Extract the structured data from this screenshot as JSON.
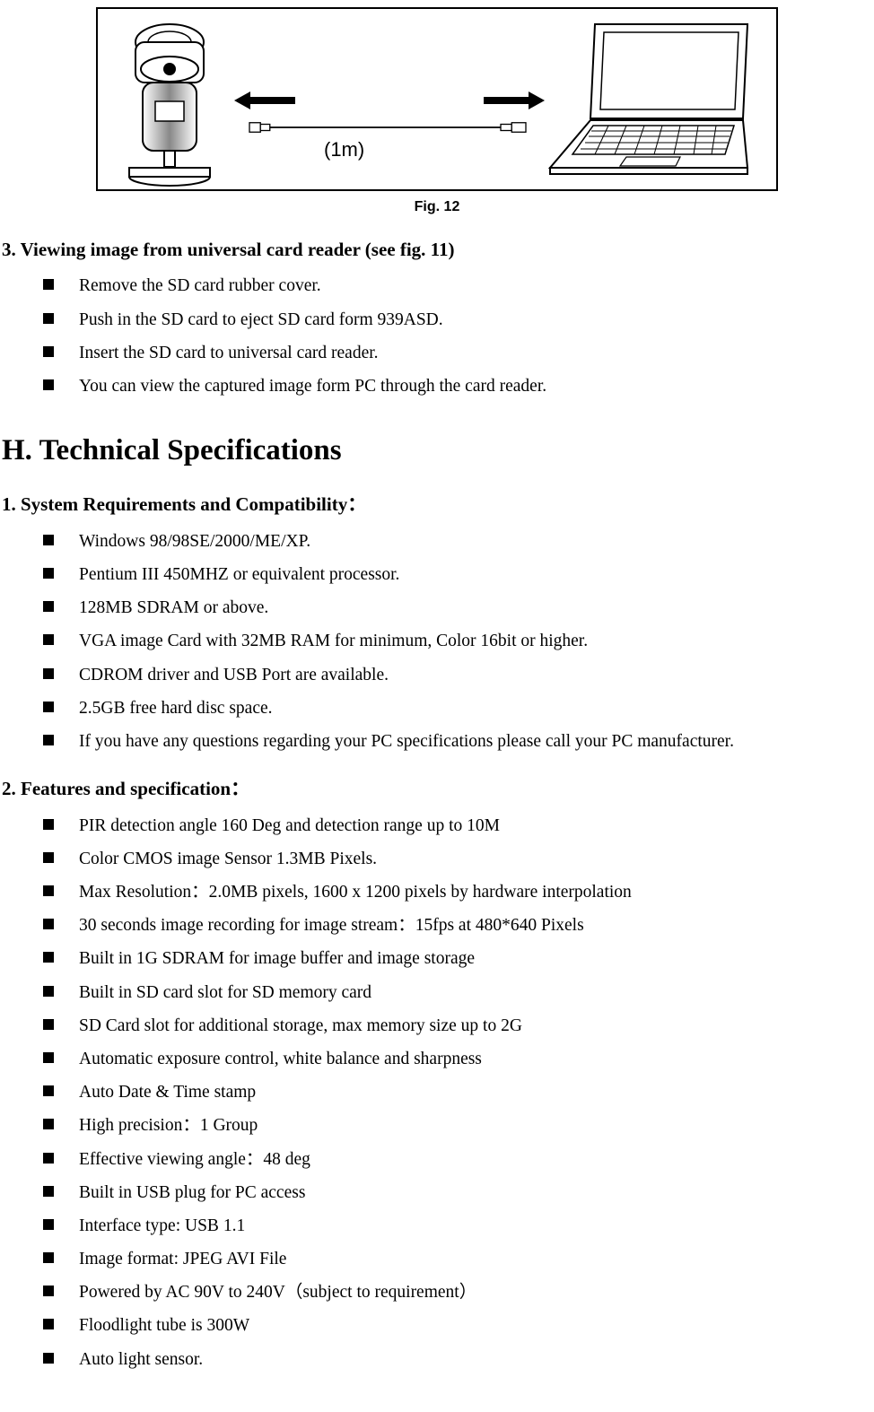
{
  "figure": {
    "cable_label": "(1m)",
    "caption": "Fig. 12"
  },
  "section3": {
    "heading": "3. Viewing image from universal card reader (see fig. 11)",
    "items": [
      "Remove the SD card rubber cover.",
      "Push in the SD card to eject SD card form 939ASD.",
      "Insert the SD card to universal card reader.",
      "You can view the captured image form PC through the card reader."
    ]
  },
  "sectionH": {
    "heading": "H. Technical Specifications",
    "sub1": {
      "heading": "1. System Requirements and Compatibility：",
      "items": [
        "Windows 98/98SE/2000/ME/XP.",
        "Pentium III 450MHZ or equivalent processor.",
        "128MB SDRAM or above.",
        "VGA image Card with 32MB RAM for minimum, Color 16bit or higher.",
        "CDROM driver and USB Port are available.",
        "2.5GB free hard disc space.",
        "If you have any questions regarding your PC specifications please call your PC manufacturer."
      ]
    },
    "sub2": {
      "heading": "2. Features and specification：",
      "items": [
        "PIR detection angle 160 Deg and detection range up to 10M",
        "Color CMOS image Sensor 1.3MB Pixels.",
        "Max Resolution：2.0MB pixels, 1600 x 1200 pixels by hardware interpolation",
        "30 seconds image recording for image stream：15fps at 480*640 Pixels",
        "Built in 1G SDRAM for image buffer and image storage",
        "Built in SD card slot for SD memory card",
        "SD Card slot for additional storage, max memory size up to 2G",
        "Automatic exposure control, white balance and sharpness",
        "Auto Date & Time stamp",
        "High precision：1 Group",
        "Effective viewing angle：48 deg",
        "Built in USB plug for PC access",
        "Interface type: USB 1.1",
        "Image format: JPEG AVI File",
        "Powered by AC 90V to 240V（subject to requirement）",
        "Floodlight tube is 300W",
        "Auto light sensor."
      ]
    }
  }
}
